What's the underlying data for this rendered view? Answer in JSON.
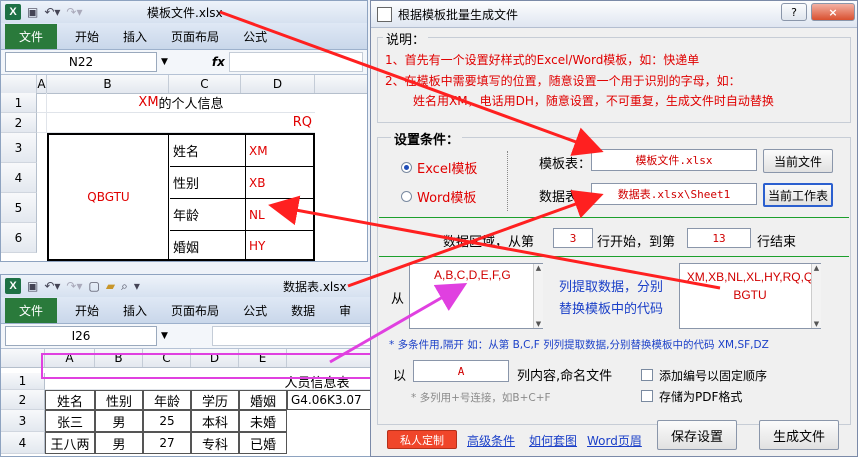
{
  "template_window": {
    "filename": "模板文件.xlsx",
    "tabs": {
      "file": "文件",
      "home": "开始",
      "insert": "插入",
      "layout": "页面布局",
      "formula": "公式"
    },
    "namebox": "N22",
    "fx": "fx",
    "col_headers": [
      "A",
      "B",
      "C",
      "D"
    ],
    "row_numbers": [
      "1",
      "2",
      "3",
      "4",
      "5",
      "6"
    ],
    "title_cell": "的个人信息",
    "title_code": "XM",
    "rq": "RQ",
    "photo_code": "QBGTU",
    "rows": [
      {
        "label": "姓名",
        "code": "XM"
      },
      {
        "label": "性别",
        "code": "XB"
      },
      {
        "label": "年龄",
        "code": "NL"
      },
      {
        "label": "婚姻",
        "code": "HY"
      }
    ]
  },
  "data_window": {
    "filename": "数据表.xlsx",
    "tabs": {
      "file": "文件",
      "home": "开始",
      "insert": "插入",
      "layout": "页面布局",
      "formula": "公式",
      "data": "数据",
      "review": "审"
    },
    "namebox": "I26",
    "col_headers": [
      "A",
      "B",
      "C",
      "D",
      "E"
    ],
    "row_numbers": [
      "1",
      "2",
      "3",
      "4"
    ],
    "title": "人员信息表",
    "headers": [
      "姓名",
      "性别",
      "年龄",
      "学历",
      "婚姻"
    ],
    "extra": "G4.06K3.07",
    "rows": [
      [
        "张三",
        "男",
        "25",
        "本科",
        "未婚"
      ],
      [
        "王八两",
        "男",
        "27",
        "专科",
        "已婚"
      ]
    ]
  },
  "dialog": {
    "title": "根据模板批量生成文件",
    "help_btn": "?",
    "close_btn": "×",
    "notes_title": "说明：",
    "notes": [
      "1、首先有一个设置好样式的Excel/Word模板，如：快递单",
      "2、在模板中需要填写的位置，随意设置一个用于识别的字母，如：",
      "姓名用XM，电话用DH，随意设置，不可重复，生成文件时自动替换"
    ],
    "settings_title": "设置条件：",
    "radio_excel": "Excel模板",
    "radio_word": "Word模板",
    "template_label": "模板表：",
    "template_value": "模板文件.xlsx",
    "current_file_btn": "当前文件",
    "data_label": "数据表：",
    "data_value": "数据表.xlsx\\Sheet1",
    "current_sheet_btn": "当前工作表",
    "range_label": "数据区域，从第",
    "range_start": "3",
    "range_mid": "行开始，到第",
    "range_end": "13",
    "range_tail": "行结束",
    "from_label": "从",
    "columns_value": "A,B,C,D,E,F,G",
    "extract_text1": "列提取数据，分别",
    "extract_text2": "替换模板中的代码",
    "codes_value": "XM,XB,NL,XL,HY,RQ,QBGTU",
    "multi_note": "* 多条件用,隔开 如：从第 B,C,F 列列提取数据,分别替换模板中的代码 XM,SF,DZ",
    "name_prefix": "以",
    "name_col": "A",
    "name_suffix": "列内容,命名文件",
    "plus_note": "* 多列用+号连接，如B+C+F",
    "chk_number": "添加编号以固定顺序",
    "chk_pdf": "存储为PDF格式",
    "custom_btn": "私人定制",
    "advanced_link": "高级条件",
    "howto_link": "如何套图",
    "word_link": "Word页眉",
    "save_btn": "保存设置",
    "generate_btn": "生成文件"
  },
  "colors": {
    "red": "#e00000",
    "arrow": "#ff2020",
    "magenta": "#e040e0",
    "excel_green": "#1e7145"
  }
}
